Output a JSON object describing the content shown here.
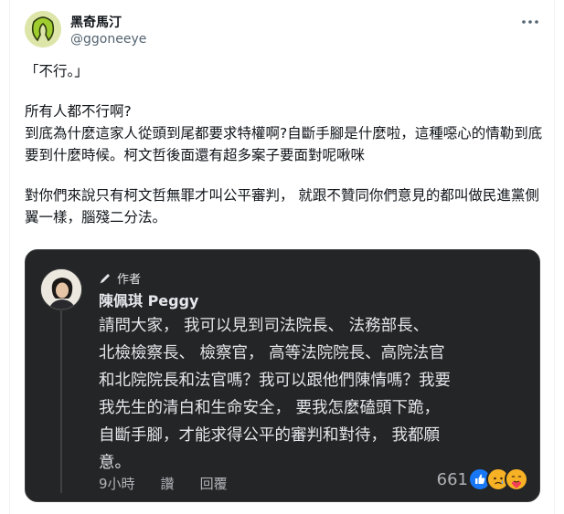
{
  "author": {
    "display_name": "黑奇馬汀",
    "handle": "@ggoneeye",
    "avatar_icon": "neck-pillow-avatar"
  },
  "more_icon": "more-dots-icon",
  "tweet": {
    "paragraphs": [
      "「不行。」",
      "所有人都不行啊?\n到底為什麼這家人從頭到尾都要求特權啊?自斷手腳是什麼啦，這種噁心的情勒到底要到什麼時候。柯文哲後面還有超多案子要面對呢啾咪",
      "對你們來說只有柯文哲無罪才叫公平審判， 就跟不贊同你們意見的都叫做民進黨側翼一樣，腦殘二分法。"
    ]
  },
  "embed": {
    "badge_label": "作者",
    "badge_icon": "pen-icon",
    "commenter_name": "陳佩琪 Peggy",
    "comment_text": "請問大家，  我可以見到司法院長、  法務部長、\n北檢檢察長、  檢察官，  高等法院院長、高院法官\n和北院院長和法官嗎？我可以跟他們陳情嗎？我要\n我先生的清白和生命安全，  要我怎麼磕頭下跪，\n自斷手腳，才能求得公平的審判和對待，  我都願\n意。",
    "time": "9小時",
    "read_label": "讚",
    "reply_label": "回覆",
    "reaction_count": "661",
    "reactions": [
      "like-icon",
      "sad-icon",
      "care-icon"
    ],
    "colors": {
      "background": "#242526",
      "like": "#1877f2",
      "sad": "#f7b125"
    }
  }
}
